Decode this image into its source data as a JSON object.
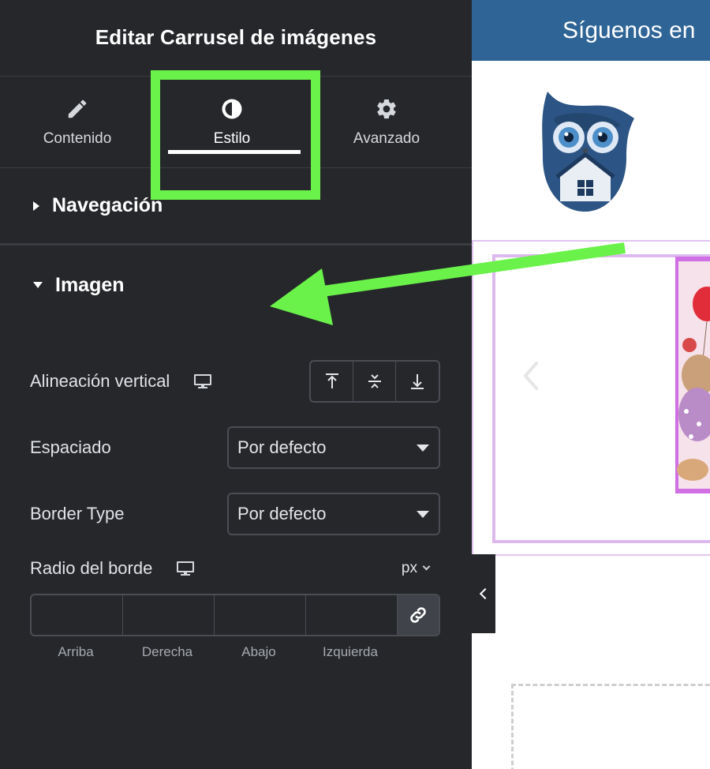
{
  "panel": {
    "title": "Editar Carrusel de imágenes",
    "tabs": [
      {
        "label": "Contenido",
        "icon": "pencil-icon"
      },
      {
        "label": "Estilo",
        "icon": "contrast-icon",
        "active": true
      },
      {
        "label": "Avanzado",
        "icon": "gear-icon"
      }
    ],
    "sections": {
      "navegacion": {
        "title": "Navegación",
        "expanded": false
      },
      "imagen": {
        "title": "Imagen",
        "expanded": true
      }
    },
    "controls": {
      "vertical_align": {
        "label": "Alineación vertical",
        "options": [
          "top",
          "middle",
          "bottom"
        ]
      },
      "spacing": {
        "label": "Espaciado",
        "value": "Por defecto"
      },
      "border_type": {
        "label": "Border Type",
        "value": "Por defecto"
      },
      "border_radius": {
        "label": "Radio del borde",
        "unit": "px",
        "fields": [
          "Arriba",
          "Derecha",
          "Abajo",
          "Izquierda"
        ],
        "values": [
          "",
          "",
          "",
          ""
        ]
      }
    }
  },
  "preview": {
    "banner_text": "Síguenos en",
    "colors": {
      "banner": "#2f6596",
      "highlight": "#6af24a",
      "carousel_border": "#dcb8ee"
    }
  }
}
